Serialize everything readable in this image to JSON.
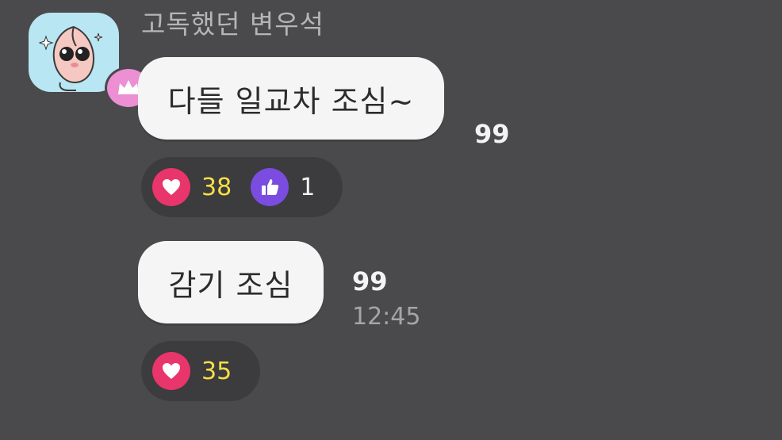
{
  "sender": {
    "name": "고독했던 변우석"
  },
  "messages": [
    {
      "text": "다들 일교차 조심~",
      "unread": "99",
      "reactions": [
        {
          "icon": "heart-icon",
          "count": "38"
        },
        {
          "icon": "thumbs-up-icon",
          "count": "1"
        }
      ]
    },
    {
      "text": "감기 조심",
      "unread": "99",
      "time": "12:45",
      "reactions": [
        {
          "icon": "heart-icon",
          "count": "35"
        }
      ]
    }
  ],
  "colors": {
    "background": "#4a494c",
    "bubble": "#f5f5f5",
    "heart": "#e8356c",
    "like": "#7a4ce0",
    "reaction_count": "#f6df47",
    "crown_badge": "#ec8fd3"
  }
}
